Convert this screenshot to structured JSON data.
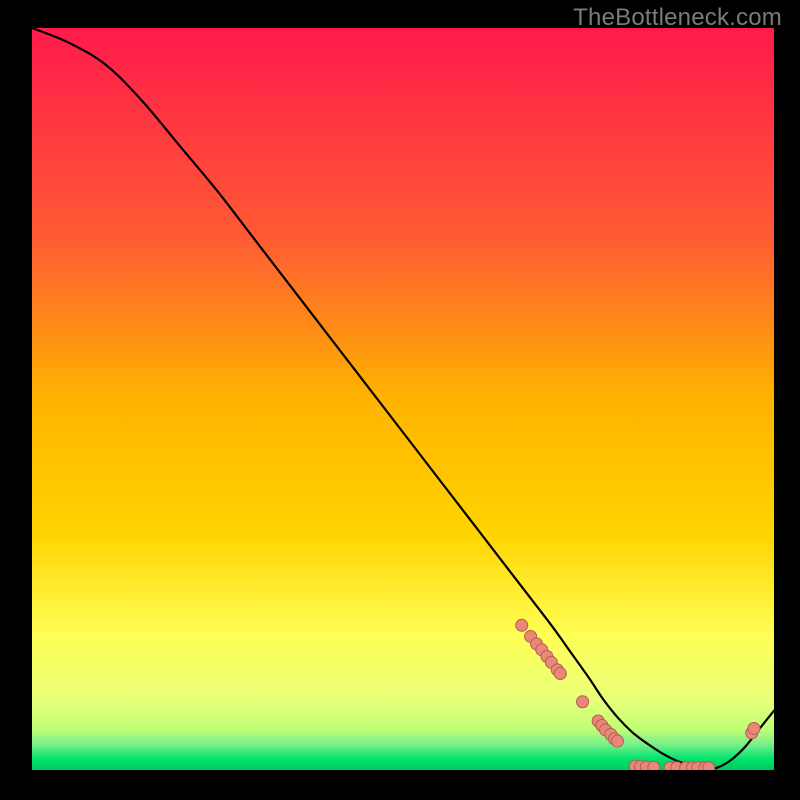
{
  "watermark": "TheBottleneck.com",
  "colors": {
    "background": "#000000",
    "gradient_top": "#ff1a4b",
    "gradient_mid1": "#ff6a2a",
    "gradient_mid2": "#ffd400",
    "gradient_mid3": "#ffff4a",
    "gradient_bottom_band": "#e9ff7a",
    "gradient_green": "#00e36c",
    "line_stroke": "#000000",
    "dot_fill": "#e9877b",
    "dot_stroke": "#b45c52"
  },
  "chart_data": {
    "type": "line",
    "title": "",
    "xlabel": "",
    "ylabel": "",
    "xlim": [
      0,
      100
    ],
    "ylim": [
      0,
      100
    ],
    "series": [
      {
        "name": "curve",
        "x": [
          0,
          5,
          10,
          15,
          20,
          25,
          30,
          35,
          40,
          45,
          50,
          55,
          60,
          65,
          70,
          72.5,
          75,
          77,
          79,
          81,
          83,
          85,
          87,
          89,
          90.5,
          92,
          94,
          96,
          98,
          100
        ],
        "y": [
          100,
          98,
          95,
          90,
          84,
          78,
          71.5,
          65,
          58.5,
          52,
          45.5,
          39,
          32.5,
          26,
          19.5,
          16,
          12.5,
          9.5,
          7,
          5,
          3.5,
          2.2,
          1.2,
          0.6,
          0.2,
          0.2,
          1.2,
          3,
          5.5,
          8
        ],
        "stroke_width": 2.2
      }
    ],
    "dots": [
      {
        "x": 66,
        "y": 19.5
      },
      {
        "x": 67.2,
        "y": 18
      },
      {
        "x": 68,
        "y": 17
      },
      {
        "x": 68.7,
        "y": 16.2
      },
      {
        "x": 69.4,
        "y": 15.3
      },
      {
        "x": 70,
        "y": 14.5
      },
      {
        "x": 70.8,
        "y": 13.5
      },
      {
        "x": 71.2,
        "y": 13
      },
      {
        "x": 74.2,
        "y": 9.2
      },
      {
        "x": 76.3,
        "y": 6.6
      },
      {
        "x": 76.8,
        "y": 6
      },
      {
        "x": 77.3,
        "y": 5.4
      },
      {
        "x": 78,
        "y": 4.8
      },
      {
        "x": 78.5,
        "y": 4.2
      },
      {
        "x": 78.9,
        "y": 3.9
      },
      {
        "x": 81.3,
        "y": 0.5
      },
      {
        "x": 82,
        "y": 0.45
      },
      {
        "x": 82.8,
        "y": 0.4
      },
      {
        "x": 83.8,
        "y": 0.35
      },
      {
        "x": 86,
        "y": 0.3
      },
      {
        "x": 86.9,
        "y": 0.3
      },
      {
        "x": 88.1,
        "y": 0.3
      },
      {
        "x": 89,
        "y": 0.3
      },
      {
        "x": 89.7,
        "y": 0.3
      },
      {
        "x": 90.7,
        "y": 0.3
      },
      {
        "x": 91.2,
        "y": 0.3
      },
      {
        "x": 97,
        "y": 5
      },
      {
        "x": 97.3,
        "y": 5.6
      }
    ],
    "dot_radius": 6
  }
}
